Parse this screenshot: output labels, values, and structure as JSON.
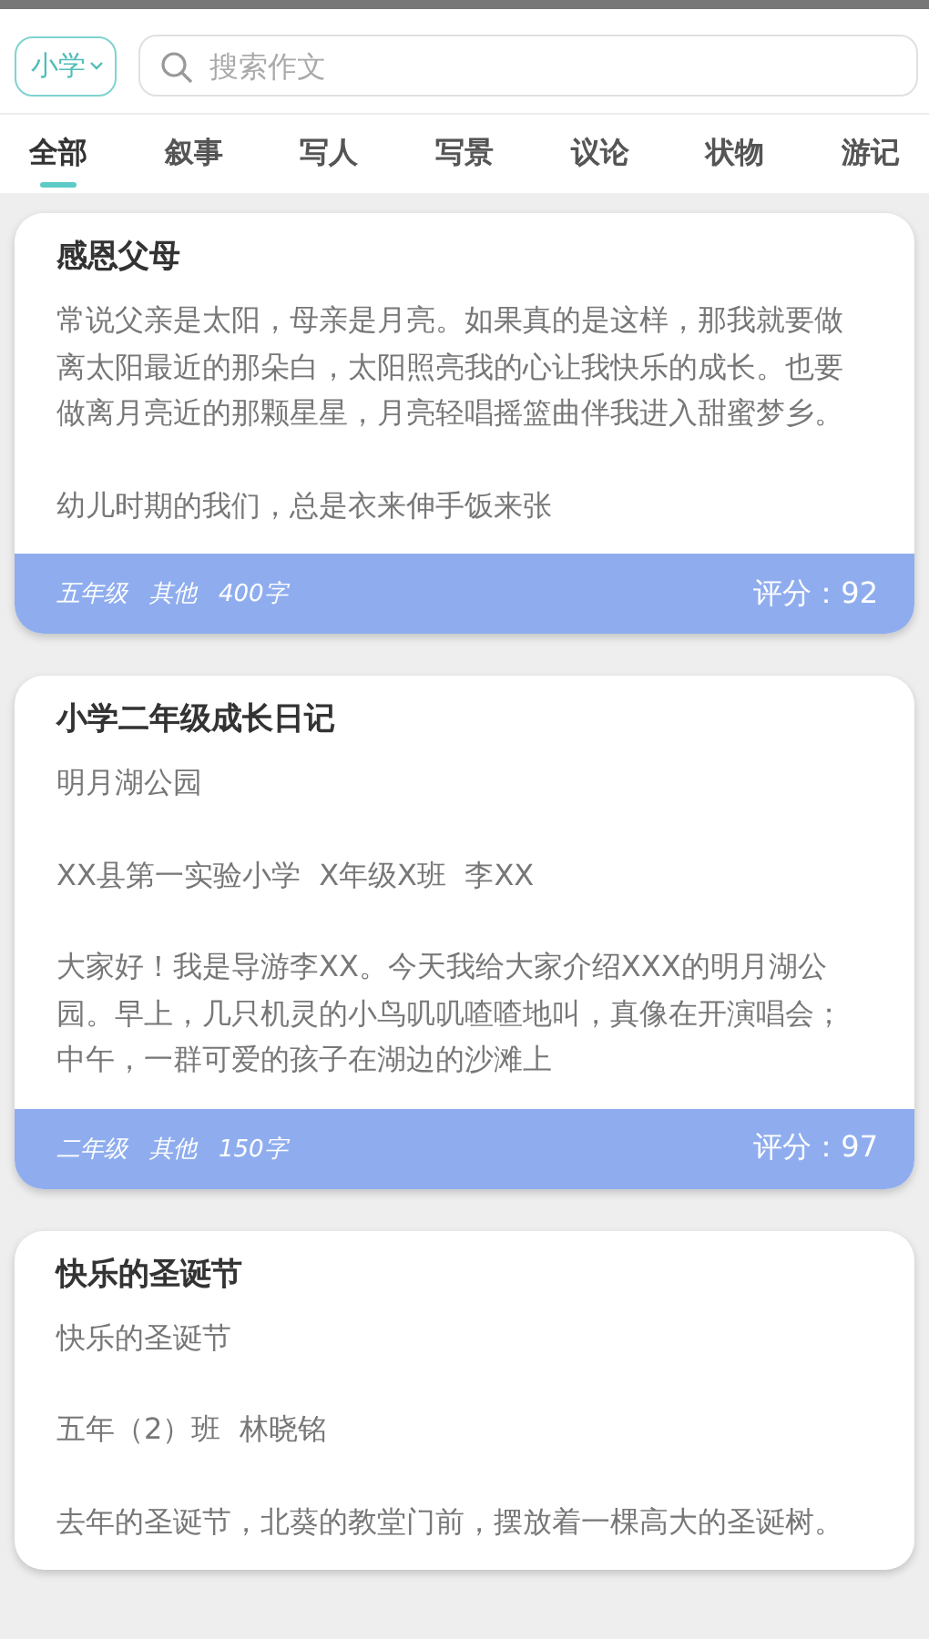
{
  "level_select": {
    "value": "小学"
  },
  "search": {
    "placeholder": "搜索作文"
  },
  "tabs": [
    {
      "label": "全部",
      "selected": true
    },
    {
      "label": "叙事",
      "selected": false
    },
    {
      "label": "写人",
      "selected": false
    },
    {
      "label": "写景",
      "selected": false
    },
    {
      "label": "议论",
      "selected": false
    },
    {
      "label": "状物",
      "selected": false
    },
    {
      "label": "游记",
      "selected": false
    }
  ],
  "essays": [
    {
      "title": "感恩父母",
      "paragraphs": [
        "常说父亲是太阳，母亲是月亮。如果真的是这样，那我就要做离太阳最近的那朵白，太阳照亮我的心让我快乐的成长。也要做离月亮近的那颗星星，月亮轻唱摇篮曲伴我进入甜蜜梦乡。",
        "幼儿时期的我们，总是衣来伸手饭来张"
      ],
      "grade": "五年级",
      "category": "其他",
      "word_count": "400字",
      "score": "评分：92"
    },
    {
      "title": "小学二年级成长日记",
      "paragraphs": [
        "明月湖公园",
        "XX县第一实验小学  X年级X班  李XX",
        "大家好！我是导游李XX。今天我给大家介绍XXX的明月湖公园。早上，几只机灵的小鸟叽叽喳喳地叫，真像在开演唱会；中午，一群可爱的孩子在湖边的沙滩上"
      ],
      "grade": "二年级",
      "category": "其他",
      "word_count": "150字",
      "score": "评分：97"
    },
    {
      "title": "快乐的圣诞节",
      "paragraphs": [
        "快乐的圣诞节",
        "五年（2）班  林晓铭",
        "去年的圣诞节，北葵的教堂门前，摆放着一棵高大的圣诞树。"
      ]
    }
  ]
}
